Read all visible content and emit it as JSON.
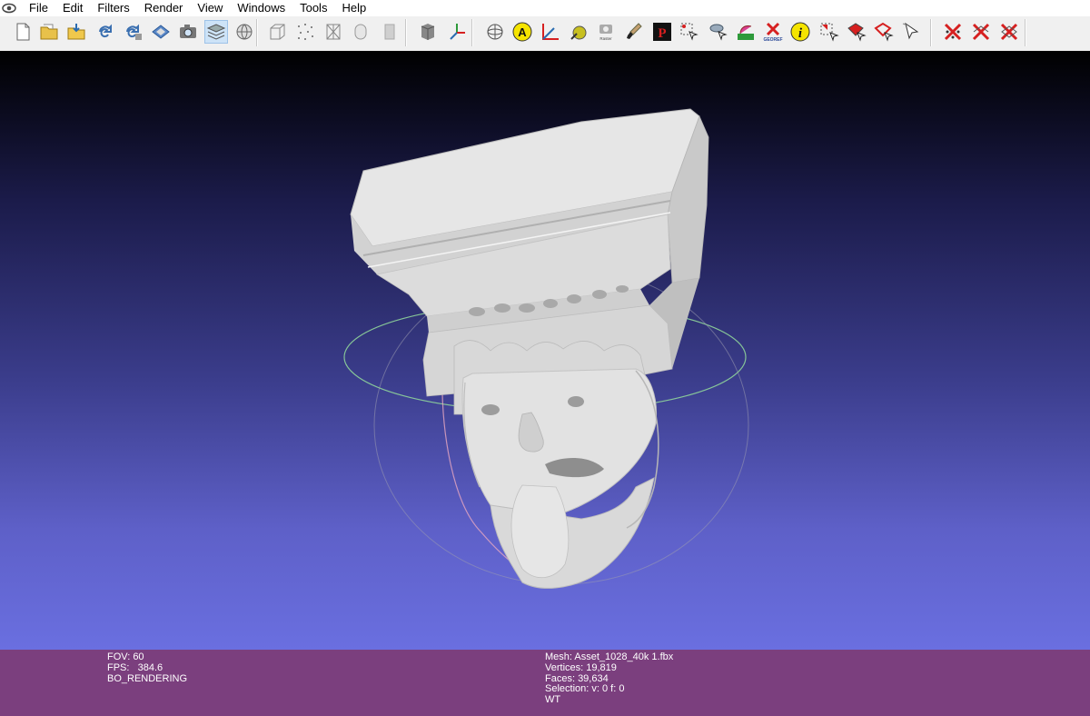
{
  "menu": [
    "File",
    "Edit",
    "Filters",
    "Render",
    "View",
    "Windows",
    "Tools",
    "Help"
  ],
  "toolbar": {
    "icons": [
      "new-project-icon",
      "open-project-icon",
      "import-mesh-icon",
      "reload-icon",
      "reload-all-icon",
      "save-icon",
      "snapshot-icon",
      "layers-icon",
      "decorate-icon",
      "bbox-icon",
      "points-icon",
      "wireframe-icon",
      "flat-shading-icon",
      "smooth-shading-icon",
      "lighting-icon",
      "axes-icon",
      "trackball-icon",
      "annotation-icon",
      "measure-icon",
      "pick-points-icon",
      "raster-align-icon",
      "paint-icon",
      "pickpoints-pp-icon",
      "select-vertices-icon",
      "align-icon",
      "paint-rabbit-icon",
      "georef-icon",
      "info-icon",
      "select-faces-icon",
      "select-connected-icon",
      "select-border-icon",
      "select-cursor-icon",
      "delete-vertices-icon",
      "delete-faces-icon",
      "delete-faces-vertices-icon"
    ],
    "active": "layers-icon",
    "georef_label": "GEOREF",
    "raster_label": "Raster Alignment"
  },
  "info_left": {
    "fov": "FOV: 60",
    "fps": "FPS:   384.6",
    "mode": "BO_RENDERING"
  },
  "info_right": {
    "mesh": "Mesh: Asset_1028_40k 1.fbx",
    "vertices": "Vertices: 19,819",
    "faces": "Faces: 39,634",
    "selection": "Selection: v: 0 f: 0",
    "wt": "WT"
  },
  "colors": {
    "menubar": "#ffffff",
    "toolbar": "#f0f0f0",
    "viewport_top": "#000000",
    "viewport_bottom": "#6a6fe0",
    "infobar": "#7b3f7e",
    "trackball_green": "#9fe0a8",
    "trackball_pink": "#e8a8c0",
    "mesh": "#e4e4e4"
  }
}
